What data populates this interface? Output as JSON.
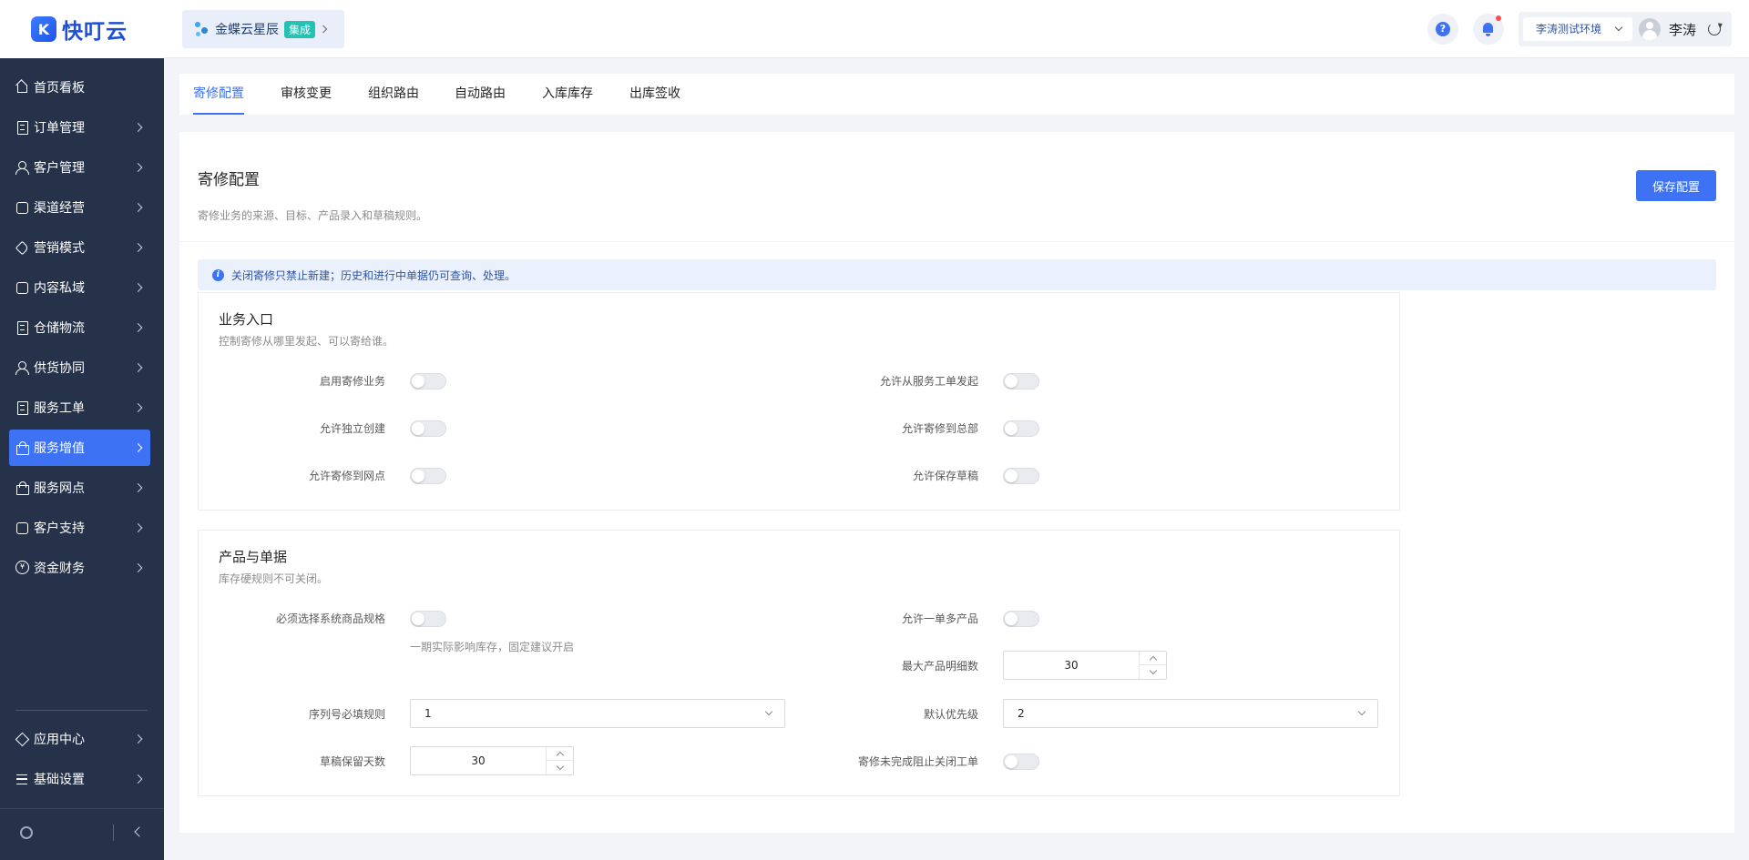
{
  "app": {
    "logo_text": "快叮云",
    "logo_mark": "K"
  },
  "sidebar": {
    "items": [
      {
        "label": "首页看板",
        "icon": "home-icon",
        "arrow": false
      },
      {
        "label": "订单管理",
        "icon": "order-icon",
        "arrow": true
      },
      {
        "label": "客户管理",
        "icon": "user-icon",
        "arrow": true
      },
      {
        "label": "渠道经营",
        "icon": "channel-icon",
        "arrow": true
      },
      {
        "label": "营销模式",
        "icon": "tag-icon",
        "arrow": true
      },
      {
        "label": "内容私域",
        "icon": "image-icon",
        "arrow": true
      },
      {
        "label": "仓储物流",
        "icon": "warehouse-icon",
        "arrow": true
      },
      {
        "label": "供货协同",
        "icon": "supply-icon",
        "arrow": true
      },
      {
        "label": "服务工单",
        "icon": "ticket-icon",
        "arrow": true
      },
      {
        "label": "服务增值",
        "icon": "bag-icon",
        "arrow": true,
        "active": true
      },
      {
        "label": "服务网点",
        "icon": "store-icon",
        "arrow": true
      },
      {
        "label": "客户支持",
        "icon": "support-icon",
        "arrow": true
      },
      {
        "label": "资金财务",
        "icon": "yuan-icon",
        "arrow": true
      }
    ],
    "bottom_items": [
      {
        "label": "应用中心",
        "icon": "cube-icon"
      },
      {
        "label": "基础设置",
        "icon": "settings-list-icon"
      }
    ]
  },
  "header": {
    "brand_name": "金蝶云星辰",
    "brand_badge": "集成",
    "env_label": "李涛测试环境",
    "user_name": "李涛"
  },
  "tabs": [
    {
      "label": "寄修配置",
      "active": true
    },
    {
      "label": "审核变更"
    },
    {
      "label": "组织路由"
    },
    {
      "label": "自动路由"
    },
    {
      "label": "入库库存"
    },
    {
      "label": "出库签收"
    }
  ],
  "page": {
    "title": "寄修配置",
    "description": "寄修业务的来源、目标、产品录入和草稿规则。",
    "save_label": "保存配置",
    "alert": "关闭寄修只禁止新建；历史和进行中单据仍可查询、处理。"
  },
  "section_entry": {
    "title": "业务入口",
    "description": "控制寄修从哪里发起、可以寄给谁。",
    "left": [
      {
        "label": "启用寄修业务",
        "on": false
      },
      {
        "label": "允许独立创建",
        "on": false
      },
      {
        "label": "允许寄修到网点",
        "on": false
      }
    ],
    "right": [
      {
        "label": "允许从服务工单发起",
        "on": false
      },
      {
        "label": "允许寄修到总部",
        "on": false
      },
      {
        "label": "允许保存草稿",
        "on": false
      }
    ]
  },
  "section_product": {
    "title": "产品与单据",
    "description": "库存硬规则不可关闭。",
    "require_spec_label": "必须选择系统商品规格",
    "require_spec_hint": "一期实际影响库存，固定建议开启",
    "multi_product_label": "允许一单多产品",
    "max_lines_label": "最大产品明细数",
    "max_lines_value": "30",
    "serial_rule_label": "序列号必填规则",
    "serial_rule_value": "1",
    "priority_label": "默认优先级",
    "priority_value": "2",
    "draft_days_label": "草稿保留天数",
    "draft_days_value": "30",
    "block_close_label": "寄修未完成阻止关闭工单"
  }
}
